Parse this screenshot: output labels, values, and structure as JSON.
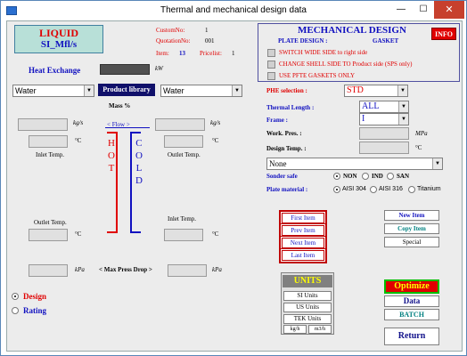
{
  "window": {
    "title": "Thermal and mechanical design data",
    "minimize": "—",
    "maximize": "☐",
    "close": "✕"
  },
  "liquid": {
    "line1": "LIQUID",
    "line2": "SI_Mfl/s"
  },
  "custom": {
    "custom_label": "CustomNo:",
    "custom_value": "1",
    "quotation_label": "QuotationNo:",
    "quotation_value": "001",
    "item_label": "Item:",
    "item_value": "13",
    "pricelist_label": "Pricelist:",
    "pricelist_value": "1"
  },
  "heat_exchange": {
    "label": "Heat Exchange",
    "unit": "kW"
  },
  "media": {
    "left": "Water",
    "right": "Water",
    "library_button": "Product library"
  },
  "mass": {
    "label": "Mass %"
  },
  "flow": {
    "label": "< Flow >",
    "hot": [
      "H",
      "O",
      "T"
    ],
    "cold": [
      "C",
      "O",
      "L",
      "D"
    ]
  },
  "units": {
    "kgs": "kg/s",
    "degc": "°C",
    "kpa": "kPa",
    "mpa": "MPa"
  },
  "labels": {
    "inlet_temp": "Inlet Temp.",
    "outlet_temp": "Outlet Temp.",
    "max_press_drop": "< Max Press Drop >"
  },
  "mode": {
    "design": "Design",
    "rating": "Rating",
    "selected": "design"
  },
  "mechanical": {
    "title": "MECHANICAL DESIGN",
    "info": "INFO",
    "plate_design": "PLATE DESIGN :",
    "gasket": "GASKET",
    "checkboxes": [
      "SWITCH  WIDE SIDE to right side",
      "CHANGE SHELL SIDE  TO Product side (SPS only)",
      "USE PFTE GASKETS ONLY"
    ],
    "phe_selection_label": "PHE selection :",
    "phe_selection_value": "STD",
    "thermal_length_label": "Thermal Length :",
    "thermal_length_value": "ALL",
    "frame_label": "Frame :",
    "frame_value": "I",
    "work_pres_label": "Work. Pres. :",
    "design_temp_label": "Design Temp. :",
    "none_value": "None",
    "sonder_safe_label": "Sonder safe",
    "sonder_options": [
      "NON",
      "IND",
      "SAN"
    ],
    "plate_material_label": "Plate material :",
    "plate_materials": [
      "AISI 304",
      "AISI 316",
      "Titanium"
    ]
  },
  "nav": {
    "first": "First Item",
    "prev": "Prev Item",
    "next": "Next Item",
    "last": "Last Item"
  },
  "item_actions": {
    "new": "New Item",
    "copy": "Copy Item",
    "special": "Special"
  },
  "units_panel": {
    "title": "UNITS",
    "si": "SI Units",
    "us": "US Units",
    "tek": "TEK Units",
    "kgh": "kg/h",
    "m3h": "m3/h"
  },
  "actions": {
    "optimize": "Optimize",
    "data": "Data",
    "batch": "BATCH",
    "return": "Return"
  }
}
